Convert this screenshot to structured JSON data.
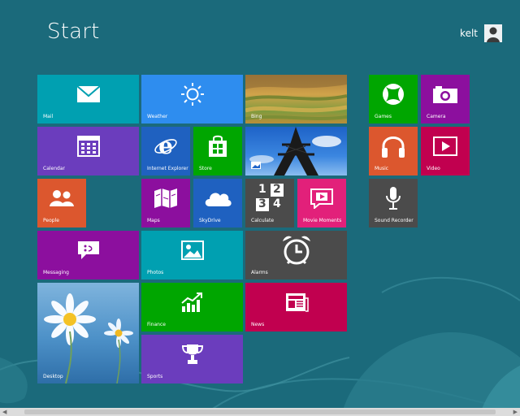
{
  "screen": {
    "title": "Start",
    "user_name": "kelt"
  },
  "tiles": {
    "mail": {
      "label": "Mail"
    },
    "weather": {
      "label": "Weather"
    },
    "bing": {
      "label": "Bing"
    },
    "calendar": {
      "label": "Calendar"
    },
    "internet_explorer": {
      "label": "Internet Explorer"
    },
    "store": {
      "label": "Store"
    },
    "people": {
      "label": "People"
    },
    "maps": {
      "label": "Maps"
    },
    "skydrive": {
      "label": "SkyDrive"
    },
    "calculate": {
      "label": "Calculate"
    },
    "movie_moments": {
      "label": "Movie Moments"
    },
    "messaging": {
      "label": "Messaging"
    },
    "photos": {
      "label": "Photos"
    },
    "alarms": {
      "label": "Alarms"
    },
    "desktop": {
      "label": "Desktop"
    },
    "finance": {
      "label": "Finance"
    },
    "news": {
      "label": "News"
    },
    "sports": {
      "label": "Sports"
    },
    "games": {
      "label": "Games"
    },
    "camera": {
      "label": "Camera"
    },
    "music": {
      "label": "Music"
    },
    "video": {
      "label": "Video"
    },
    "sound_recorder": {
      "label": "Sound Recorder"
    }
  },
  "calculator_digits": {
    "d1": "1",
    "d2": "2",
    "d3": "3",
    "d4": "4"
  },
  "colors": {
    "background": "#1b6a7b",
    "teal": "#00a0b1",
    "blue": "#2e8def",
    "purple": "#8c26a8",
    "violet": "#6b3dbd",
    "green": "#00a600",
    "orange": "#dc572e",
    "crimson": "#c1004f",
    "gray": "#4b4b4b",
    "magenta": "#e2207a",
    "dark_blue": "#1f61c0"
  }
}
